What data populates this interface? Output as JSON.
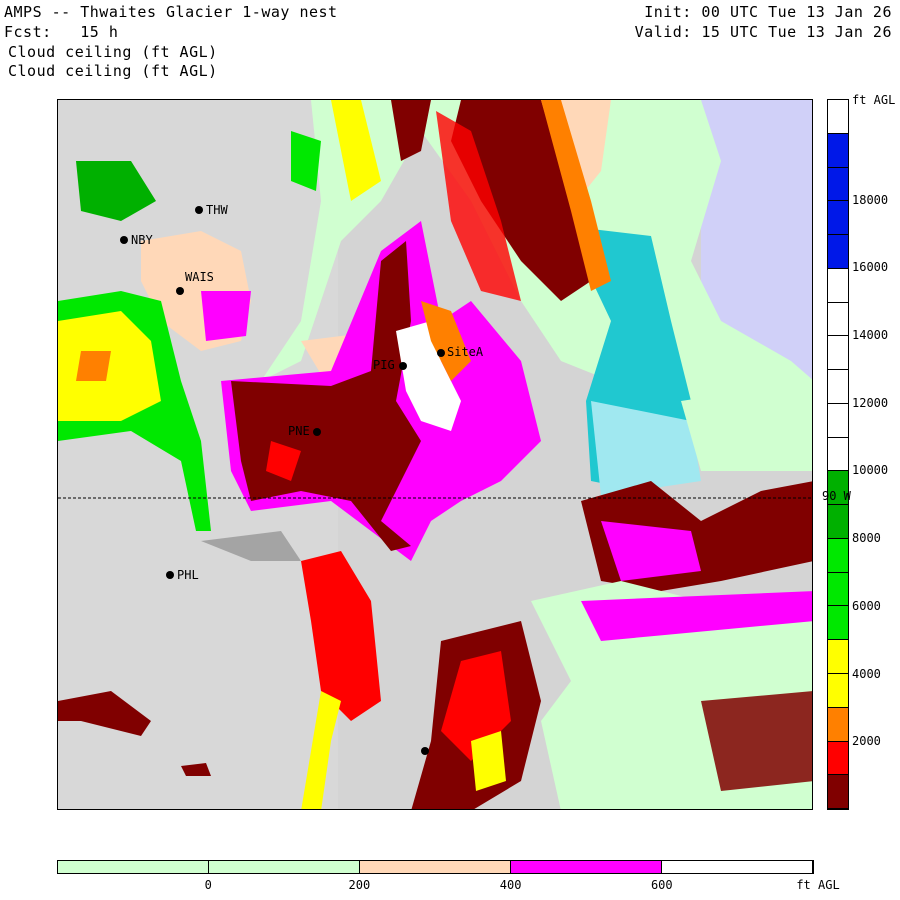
{
  "header": {
    "title": "AMPS -- Thwaites Glacier 1-way nest",
    "forecast": "Fcst:   15 h",
    "field_line1": "Cloud ceiling (ft AGL)",
    "field_line2": "Cloud ceiling (ft AGL)",
    "init": "Init: 00 UTC Tue 13 Jan 26",
    "valid": "Valid: 15 UTC Tue 13 Jan 26"
  },
  "map": {
    "meridian_label": "90 W",
    "stations": [
      "THW",
      "NBY",
      "WAIS",
      "PIG",
      "SiteA",
      "PNE",
      "PHL"
    ]
  },
  "colorbar_vertical": {
    "units": "ft AGL",
    "labels": [
      "18000",
      "16000",
      "14000",
      "12000",
      "10000",
      "8000",
      "6000",
      "4000",
      "2000"
    ],
    "colors": [
      "#ffffff",
      "#0018e8",
      "#0018e8",
      "#0018e8",
      "#0018e8",
      "#ffffff",
      "#ffffff",
      "#ffffff",
      "#ffffff",
      "#ffffff",
      "#ffffff",
      "#00b000",
      "#00b000",
      "#00e800",
      "#00e800",
      "#00e800",
      "#ffff00",
      "#ffff00",
      "#ff8000",
      "#ff0000",
      "#800000"
    ]
  },
  "colorbar_horizontal": {
    "units": "ft AGL",
    "labels": [
      "0",
      "200",
      "400",
      "600"
    ],
    "colors": [
      "#d0ffd0",
      "#d0ffd0",
      "#ffd8b8",
      "#ff00ff",
      "#ffffff"
    ]
  }
}
